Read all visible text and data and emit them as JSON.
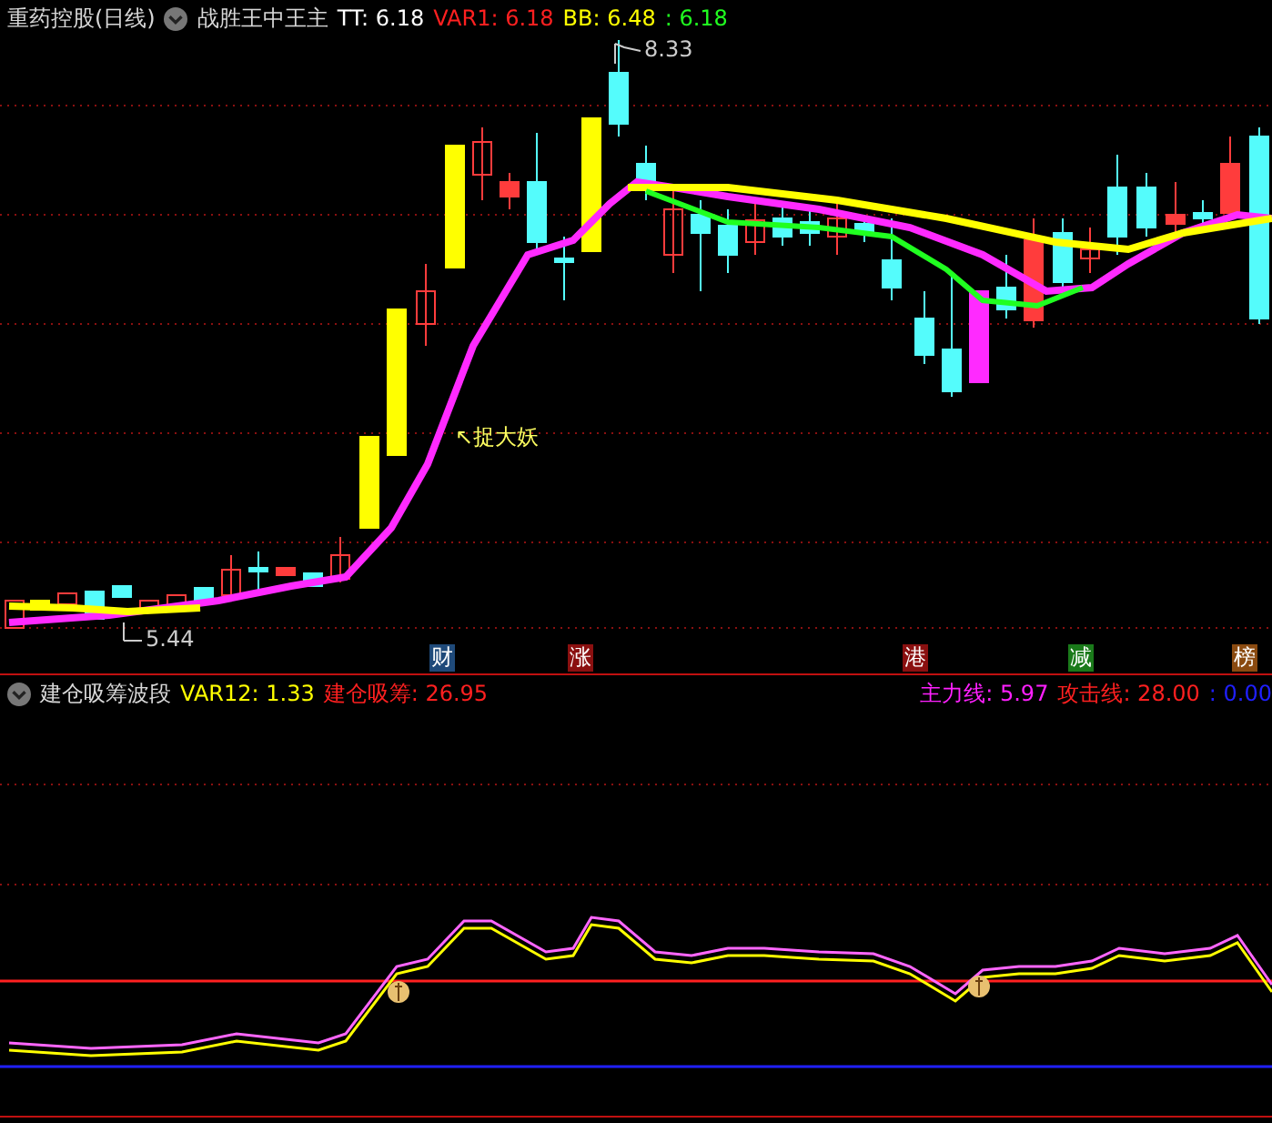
{
  "main_header": {
    "stock": "重药控股(日线)",
    "indicator": "战胜王中王主",
    "values": [
      {
        "label": "TT: ",
        "value": "6.18",
        "color": "#ffffff"
      },
      {
        "label": "VAR1: ",
        "value": "6.18",
        "color": "#ff2020"
      },
      {
        "label": "BB: ",
        "value": "6.48",
        "color": "#ffff00"
      },
      {
        "label": " : ",
        "value": "6.18",
        "color": "#20ff20"
      }
    ]
  },
  "price_marks": {
    "high": "8.33",
    "low": "5.44"
  },
  "signal_label": "↖捉大妖",
  "event_tags": [
    {
      "text": "财",
      "color": "#1f4a7a"
    },
    {
      "text": "涨",
      "color": "#8a1010"
    },
    {
      "text": "港",
      "color": "#8a1010"
    },
    {
      "text": "减",
      "color": "#1a7a1a"
    },
    {
      "text": "榜",
      "color": "#8a4a10"
    }
  ],
  "sub_header": {
    "name": "建仓吸筹波段",
    "left_values": [
      {
        "label": "VAR12: ",
        "value": "1.33",
        "color": "#ffff00"
      },
      {
        "label": "建仓吸筹: ",
        "value": "26.95",
        "color": "#ff2020"
      }
    ],
    "right_values": [
      {
        "label": "主力线: ",
        "value": "5.97",
        "color": "#ff20ff"
      },
      {
        "label": "攻击线: ",
        "value": "28.00",
        "color": "#ff2020"
      },
      {
        "label": " : ",
        "value": "0.00",
        "color": "#2020ff"
      }
    ]
  }
}
